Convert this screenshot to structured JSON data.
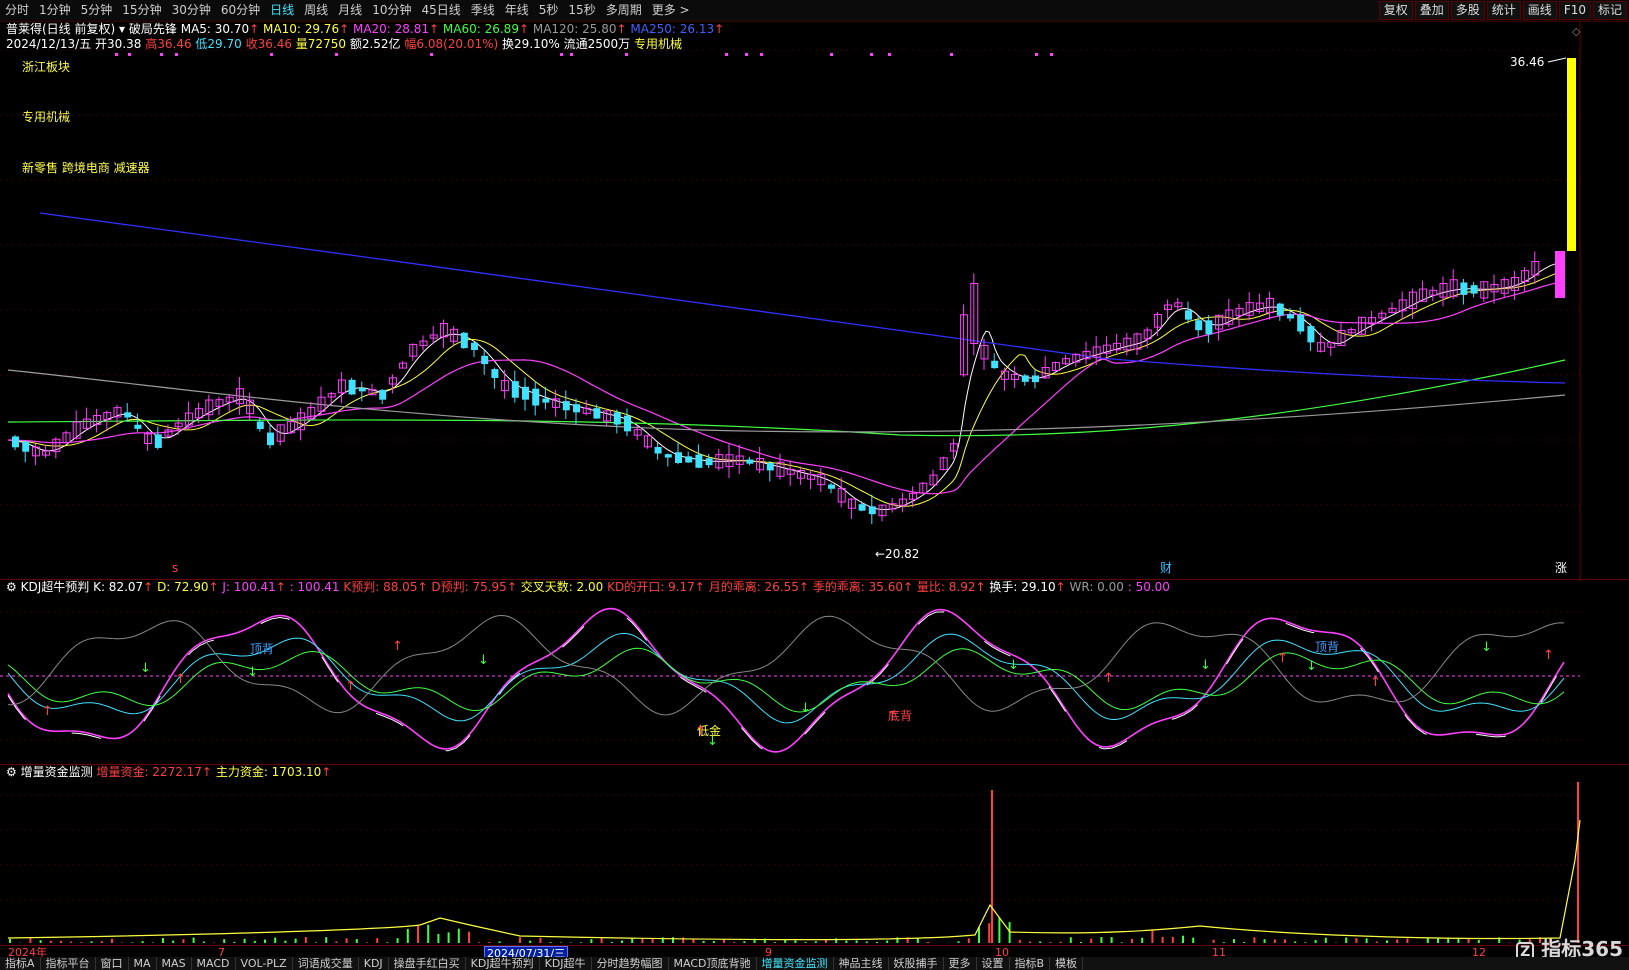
{
  "toolbar": {
    "periods": [
      "分时",
      "1分钟",
      "5分钟",
      "15分钟",
      "30分钟",
      "60分钟",
      "日线",
      "周线",
      "月线",
      "10分钟",
      "45日线",
      "季线",
      "年线",
      "5秒",
      "15秒",
      "多周期",
      "更多 >"
    ],
    "active": "日线",
    "right_buttons": [
      "复权",
      "叠加",
      "多股",
      "统计",
      "画线",
      "F10",
      "标记"
    ]
  },
  "header": {
    "stock_title": "普莱得(日线 前复权)",
    "indicator_name": "破局先锋",
    "ma5": "MA5: 30.70",
    "ma10": "MA10: 29.76",
    "ma20": "MA20: 28.81",
    "ma60": "MA60: 26.89",
    "ma120": "MA120: 25.80",
    "ma250": "MA250: 26.13",
    "date": "2024/12/13/五",
    "open": "开30.38",
    "high": "高36.46",
    "low": "低29.70",
    "close": "收36.46",
    "volume": "量72750",
    "amount": "额2.52亿",
    "change": "幅6.08(20.01%)",
    "turnover": "换29.10%",
    "float": "流通2500万",
    "industry": "专用机械"
  },
  "labels": {
    "sector1": "浙江板块",
    "sector2": "专用机械",
    "sector3": "新零售 跨境电商 减速器",
    "price_high": "36.46",
    "price_low": "20.82",
    "mark_s": "s",
    "mark_cai": "财",
    "mark_zhang": "涨",
    "top_back1": "顶背",
    "top_back2": "顶背",
    "low_gold": "低金",
    "bottom_back": "底背"
  },
  "kdj": {
    "title": "KDJ超牛预判",
    "k": "K: 82.07",
    "d": "D: 72.90",
    "j": "J: 100.41",
    "blank": ": 100.41",
    "k_pred": "K预判: 88.05",
    "d_pred": "D预判: 75.95",
    "cross_days": "交叉天数: 2.00",
    "kd_open": "KD的开口: 9.17",
    "month_dev": "月的乖离: 26.55",
    "season_dev": "季的乖离: 35.60",
    "vol_ratio": "量比: 8.92",
    "turnover": "换手: 29.10",
    "wr": "WR: 0.00",
    "level": ": 50.00"
  },
  "fund": {
    "title": "增量资金监测",
    "incr": "增量资金: 2272.17",
    "main": "主力资金: 1703.10"
  },
  "xaxis": {
    "year": "2024年",
    "m7": "7",
    "m9": "9",
    "m10": "10",
    "m11": "11",
    "m12": "12",
    "cursor_date": "2024/07/31/三"
  },
  "bottom_tabs": [
    "指标A",
    "指标平台",
    "窗口",
    "MA",
    "MAS",
    "MACD",
    "VOL-PLZ",
    "词语成交量",
    "KDJ",
    "操盘手红白买",
    "KDJ超牛预判",
    "KDJ超牛",
    "分时趋势幅图",
    "MACD顶底背驰",
    "增量资金监测",
    "神品主线",
    "妖股捕手",
    "更多",
    "设置",
    "指标B",
    "模板"
  ],
  "selected_tab": "增量资金监测",
  "logo": "指标365",
  "colors": {
    "up": "#ff40ff",
    "down": "#40e0ff",
    "ma5": "#ffffff",
    "ma10": "#ffff40",
    "ma20": "#ff40ff",
    "ma60": "#40ff40",
    "ma120": "#9a9a9a",
    "ma250": "#3030ff"
  }
}
